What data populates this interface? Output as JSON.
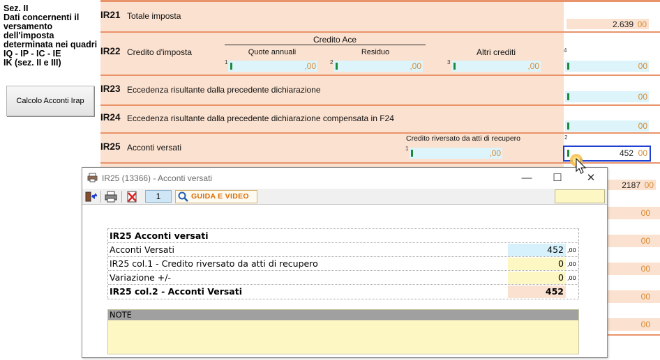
{
  "left_panel": {
    "section_title": "Sez. II\nDati concernenti il versamento\ndell'imposta\ndeterminata nei quadri\nIQ - IP - IC - IE\nIK (sez. II e III)",
    "calc_button": "Calcolo Acconti Irap"
  },
  "form": {
    "ir21": {
      "code": "IR21",
      "label": "Totale imposta",
      "value": "2.639",
      "dec": "00"
    },
    "ir22": {
      "code": "IR22",
      "label": "Credito d'imposta",
      "group_header": "Credito Ace",
      "col1_header": "Quote annuali",
      "col2_header": "Residuo",
      "col3_header": "Altri crediti",
      "idx1": "1",
      "idx2": "2",
      "idx3": "3",
      "idx4": "4",
      "f1_dec": ",00",
      "f2_dec": ",00",
      "f3_dec": ",00",
      "f4_dec": "00"
    },
    "ir23": {
      "code": "IR23",
      "label": "Eccedenza risultante dalla precedente dichiarazione",
      "dec": "00"
    },
    "ir24": {
      "code": "IR24",
      "label": "Eccedenza risultante dalla precedente dichiarazione compensata in F24",
      "dec": "00"
    },
    "ir25": {
      "code": "IR25",
      "label": "Acconti versati",
      "sub_header": "Credito riversato da atti di recupero",
      "idx1": "1",
      "idx2": "2",
      "f1_dec": ",00",
      "value": "452",
      "dec": "00"
    },
    "below_popup": {
      "value": "2187",
      "dec": "00",
      "dec_rows": [
        "00",
        "00",
        "00",
        "00",
        "00"
      ]
    }
  },
  "popup": {
    "title": "IR25 (13366) - Acconti versati",
    "window_controls": {
      "minimize": "—",
      "maximize": "☐",
      "close": "✕"
    },
    "toolbar": {
      "page_number": "1",
      "guida_label": "GUIDA E VIDEO"
    },
    "table": {
      "header": "IR25 Acconti versati",
      "rows": [
        {
          "label": "Acconti Versati",
          "value": "452",
          "dec": ",00"
        },
        {
          "label": "IR25 col.1  - Credito riversato da atti di recupero",
          "value": "0",
          "dec": ",00"
        },
        {
          "label": "Variazione +/-",
          "value": "0",
          "dec": ",00"
        }
      ],
      "total": {
        "label": "IR25 col.2 - Acconti Versati",
        "value": "452"
      }
    },
    "notes_label": "NOTE"
  },
  "colors": {
    "form_background": "#fbe1cf",
    "separator": "#e9936a",
    "input_blue": "#ddf4fb",
    "input_yellow": "#fdf7c3",
    "highlight": "#1f3fd3",
    "guida_text": "#d96b00"
  }
}
